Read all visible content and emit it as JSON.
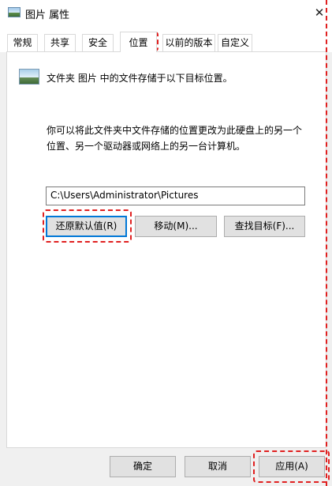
{
  "window": {
    "title": "图片 属性",
    "close_icon": "close-icon"
  },
  "tabs": [
    {
      "label": "常规"
    },
    {
      "label": "共享"
    },
    {
      "label": "安全"
    },
    {
      "label": "位置",
      "selected": true
    },
    {
      "label": "以前的版本"
    },
    {
      "label": "自定义"
    }
  ],
  "location": {
    "icon": "folder-picture-icon",
    "description": "文件夹 图片 中的文件存储于以下目标位置。",
    "hint_line1": "你可以将此文件夹中文件存储的位置更改为此硬盘上的另一个",
    "hint_line2": "位置、另一个驱动器或网络上的另一台计算机。",
    "path": "C:\\Users\\Administrator\\Pictures",
    "restore_label": "还原默认值(R)",
    "move_label": "移动(M)...",
    "find_label": "查找目标(F)..."
  },
  "footer": {
    "ok_label": "确定",
    "cancel_label": "取消",
    "apply_label": "应用(A)"
  },
  "colors": {
    "annotation": "#e02020",
    "focus": "#0078d7"
  }
}
